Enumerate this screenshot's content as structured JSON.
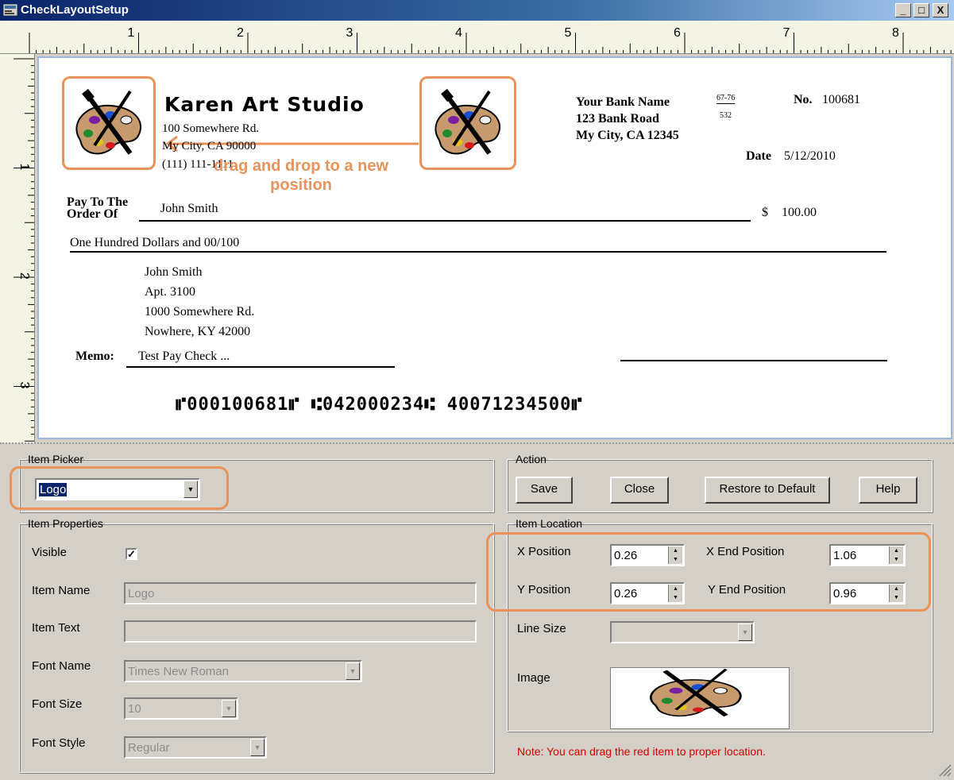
{
  "window": {
    "title": "CheckLayoutSetup",
    "minimize_label": "_",
    "maximize_label": "□",
    "close_label": "X"
  },
  "ruler": {
    "h_numbers": [
      "1",
      "2",
      "3",
      "4",
      "5",
      "6",
      "7",
      "8"
    ],
    "v_numbers": [
      "1",
      "2",
      "3"
    ]
  },
  "check": {
    "company_name": "Karen Art Studio",
    "company_address1": "100 Somewhere Rd.",
    "company_address2": "My City, CA 90000",
    "company_phone": "(111) 111-1111",
    "drag_note": "drag and drop to a new position",
    "bank_name": "Your Bank Name",
    "bank_address1": "123 Bank Road",
    "bank_address2": "My City, CA 12345",
    "fraction_top": "67-76",
    "fraction_bottom": "532",
    "number_label": "No.",
    "number_value": "100681",
    "date_label": "Date",
    "date_value": "5/12/2010",
    "pay_to_label1": "Pay To The",
    "pay_to_label2": "Order Of",
    "payee": "John Smith",
    "dollar_sign": "$",
    "amount": "100.00",
    "amount_words": "One Hundred  Dollars and 00/100",
    "address_lines": [
      "John Smith",
      "Apt. 3100",
      "1000 Somewhere Rd.",
      "Nowhere, KY 42000"
    ],
    "memo_label": "Memo:",
    "memo_text": "Test Pay Check ...",
    "micr_line": "⑈000100681⑈ ⑆042000234⑆ 40071234500⑈"
  },
  "item_picker": {
    "legend": "Item Picker",
    "selected": "Logo"
  },
  "item_properties": {
    "legend": "Item Properties",
    "visible_label": "Visible",
    "visible_checked": true,
    "check_mark": "✓",
    "item_name_label": "Item Name",
    "item_name_value": "Logo",
    "item_text_label": "Item Text",
    "item_text_value": "",
    "font_name_label": "Font Name",
    "font_name_value": "Times New Roman",
    "font_size_label": "Font Size",
    "font_size_value": "10",
    "font_style_label": "Font Style",
    "font_style_value": "Regular"
  },
  "action": {
    "legend": "Action",
    "save_label": "Save",
    "close_label": "Close",
    "restore_label": "Restore to Default",
    "help_label": "Help"
  },
  "item_location": {
    "legend": "Item Location",
    "x_label": "X Position",
    "x_value": "0.26",
    "x_end_label": "X End Position",
    "x_end_value": "1.06",
    "y_label": "Y Position",
    "y_value": "0.26",
    "y_end_label": "Y End Position",
    "y_end_value": "0.96",
    "line_size_label": "Line Size",
    "line_size_value": "",
    "image_label": "Image",
    "note": "Note: You can drag the red item to proper location."
  },
  "icons": [
    "app-icon",
    "palette-icon",
    "dropdown-arrow-icon",
    "spinner-icon",
    "resize-grip-icon"
  ],
  "colors": {
    "highlight": "#e8935a",
    "titlebar": "#0a246a",
    "note": "#d40000",
    "canvas_border": "#9bb7d9"
  }
}
